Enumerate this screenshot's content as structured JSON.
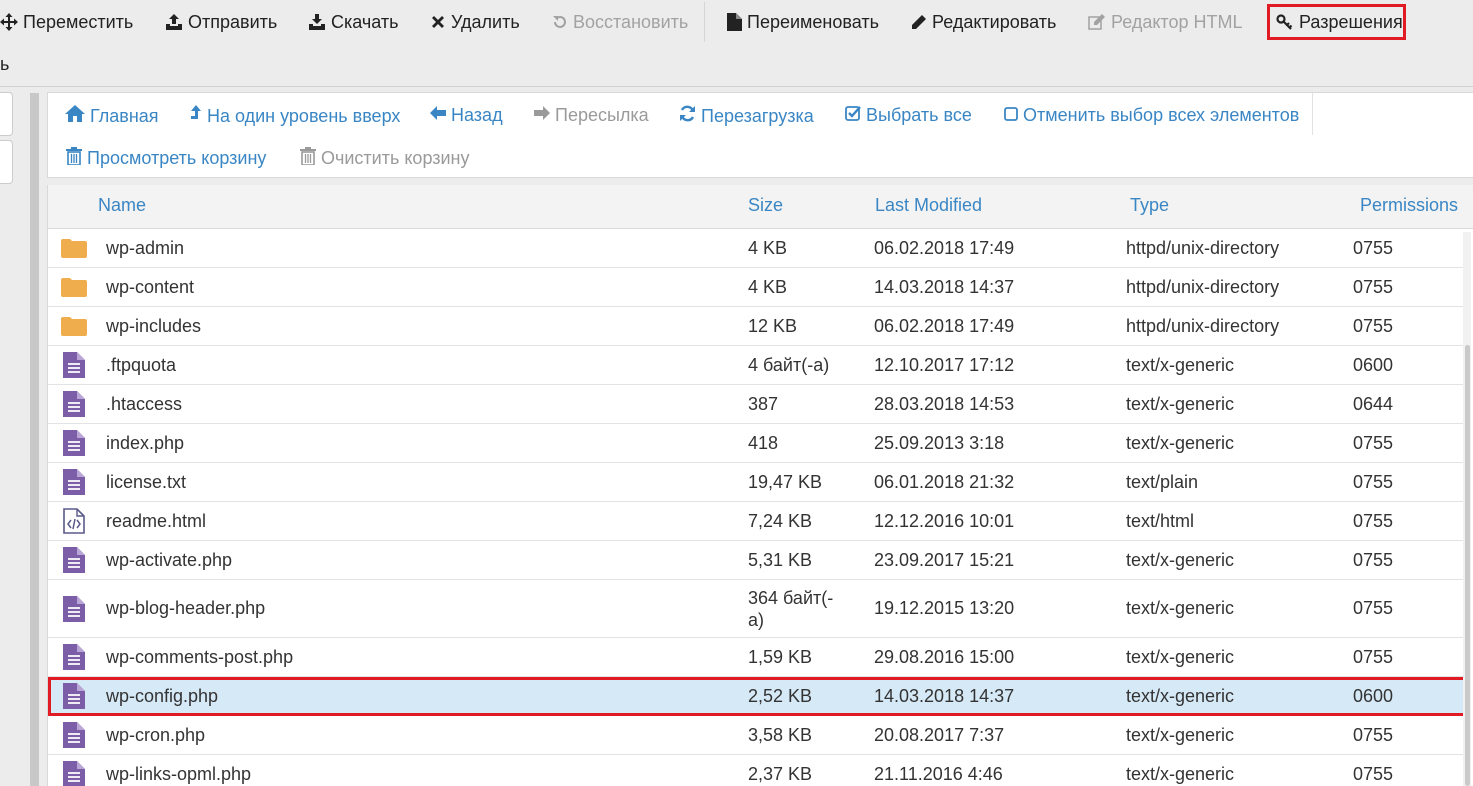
{
  "toolbar": {
    "move": "Переместить",
    "upload": "Отправить",
    "download": "Скачать",
    "delete": "Удалить",
    "restore": "Восстановить",
    "rename": "Переименовать",
    "edit": "Редактировать",
    "html_editor": "Редактор HTML",
    "permissions": "Разрешения",
    "overflow": "ь"
  },
  "nav": {
    "home": "Главная",
    "up": "На один уровень вверх",
    "back": "Назад",
    "forward": "Пересылка",
    "reload": "Перезагрузка",
    "select_all": "Выбрать все",
    "deselect_all": "Отменить выбор всех элементов",
    "view_trash": "Просмотреть корзину",
    "empty_trash": "Очистить корзину"
  },
  "table": {
    "columns": [
      "Name",
      "Size",
      "Last Modified",
      "Type",
      "Permissions"
    ],
    "rows": [
      {
        "icon": "folder-icon",
        "name": "wp-admin",
        "size": "4 KB",
        "modified": "06.02.2018 17:49",
        "type": "httpd/unix-directory",
        "perm": "0755"
      },
      {
        "icon": "folder-icon",
        "name": "wp-content",
        "size": "4 KB",
        "modified": "14.03.2018 14:37",
        "type": "httpd/unix-directory",
        "perm": "0755"
      },
      {
        "icon": "folder-icon",
        "name": "wp-includes",
        "size": "12 KB",
        "modified": "06.02.2018 17:49",
        "type": "httpd/unix-directory",
        "perm": "0755"
      },
      {
        "icon": "file-text-icon",
        "name": ".ftpquota",
        "size": "4 байт(-а)",
        "modified": "12.10.2017 17:12",
        "type": "text/x-generic",
        "perm": "0600"
      },
      {
        "icon": "file-text-icon",
        "name": ".htaccess",
        "size": "387",
        "modified": "28.03.2018 14:53",
        "type": "text/x-generic",
        "perm": "0644"
      },
      {
        "icon": "file-text-icon",
        "name": "index.php",
        "size": "418",
        "modified": "25.09.2013 3:18",
        "type": "text/x-generic",
        "perm": "0755"
      },
      {
        "icon": "file-text-icon",
        "name": "license.txt",
        "size": "19,47 KB",
        "modified": "06.01.2018 21:32",
        "type": "text/plain",
        "perm": "0755"
      },
      {
        "icon": "file-code-icon",
        "name": "readme.html",
        "size": "7,24 KB",
        "modified": "12.12.2016 10:01",
        "type": "text/html",
        "perm": "0755"
      },
      {
        "icon": "file-text-icon",
        "name": "wp-activate.php",
        "size": "5,31 KB",
        "modified": "23.09.2017 15:21",
        "type": "text/x-generic",
        "perm": "0755"
      },
      {
        "icon": "file-text-icon",
        "name": "wp-blog-header.php",
        "size": "364 байт(-а)",
        "modified": "19.12.2015 13:20",
        "type": "text/x-generic",
        "perm": "0755"
      },
      {
        "icon": "file-text-icon",
        "name": "wp-comments-post.php",
        "size": "1,59 KB",
        "modified": "29.08.2016 15:00",
        "type": "text/x-generic",
        "perm": "0755"
      },
      {
        "icon": "file-text-icon",
        "name": "wp-config.php",
        "size": "2,52 KB",
        "modified": "14.03.2018 14:37",
        "type": "text/x-generic",
        "perm": "0600",
        "selected": true
      },
      {
        "icon": "file-text-icon",
        "name": "wp-cron.php",
        "size": "3,58 KB",
        "modified": "20.08.2017 7:37",
        "type": "text/x-generic",
        "perm": "0755"
      },
      {
        "icon": "file-text-icon",
        "name": "wp-links-opml.php",
        "size": "2,37 KB",
        "modified": "21.11.2016 4:46",
        "type": "text/x-generic",
        "perm": "0755"
      }
    ]
  },
  "colors": {
    "link_blue": "#3a86c4",
    "highlight_red": "#e01b24",
    "selected_row": "#d6e9f7",
    "folder": "#f0ad4e",
    "file": "#7b5ea7"
  }
}
